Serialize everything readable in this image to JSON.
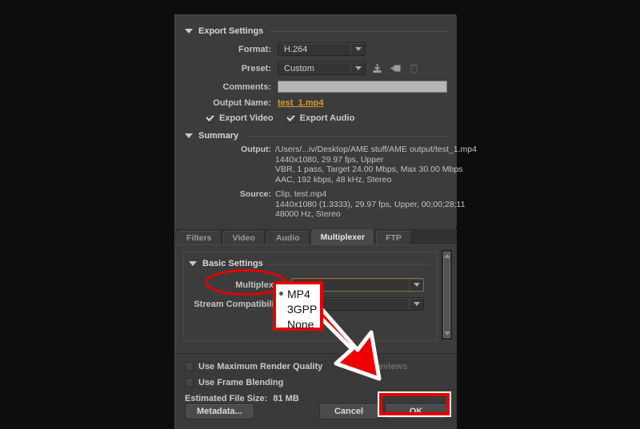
{
  "export_settings": {
    "title": "Export Settings",
    "format_label": "Format:",
    "format_value": "H.264",
    "preset_label": "Preset:",
    "preset_value": "Custom",
    "comments_label": "Comments:",
    "comments_value": "",
    "output_name_label": "Output Name:",
    "output_name_value": "test_1.mp4",
    "export_video_label": "Export Video",
    "export_audio_label": "Export Audio",
    "icons": {
      "save_preset": "save-preset-icon",
      "import_preset": "import-preset-icon",
      "delete_preset": "delete-preset-icon"
    }
  },
  "summary": {
    "title": "Summary",
    "output_key": "Output:",
    "output_lines": [
      "/Users/...iv/Desktop/AME stuff/AME output/test_1.mp4",
      "1440x1080, 29.97 fps, Upper",
      "VBR, 1 pass, Target 24.00 Mbps, Max 30.00 Mbps",
      "AAC, 192 kbps, 48 kHz, Stereo"
    ],
    "source_key": "Source:",
    "source_lines": [
      "Clip, test.mp4",
      "1440x1080 (1.3333), 29.97 fps, Upper, 00;00;28;11",
      "48000 Hz, Stereo"
    ]
  },
  "tabs": [
    {
      "label": "Filters",
      "active": false
    },
    {
      "label": "Video",
      "active": false
    },
    {
      "label": "Audio",
      "active": false
    },
    {
      "label": "Multiplexer",
      "active": true
    },
    {
      "label": "FTP",
      "active": false
    }
  ],
  "basic_settings": {
    "title": "Basic Settings",
    "multiplexer_label": "Multiplexer:",
    "multiplexer_value": "MP4",
    "stream_compat_label": "Stream Compatibility:",
    "stream_compat_value": ""
  },
  "dropdown_popup": {
    "options": [
      "MP4",
      "3GPP",
      "None"
    ],
    "selected": "MP4"
  },
  "bottom": {
    "max_render_quality_label": "Use Maximum Render Quality",
    "use_previews_label": "Use Previews",
    "frame_blending_label": "Use Frame Blending",
    "estimated_file_size_label": "Estimated File Size:",
    "estimated_file_size_value": "81 MB",
    "metadata_button": "Metadata...",
    "cancel_button": "Cancel",
    "ok_button": "OK"
  },
  "annotations": {
    "highlight_color": "#e60000",
    "arrow_fill": "#ee0000",
    "arrow_stroke": "#ffffff",
    "focus_border_color": "#8a7238"
  }
}
